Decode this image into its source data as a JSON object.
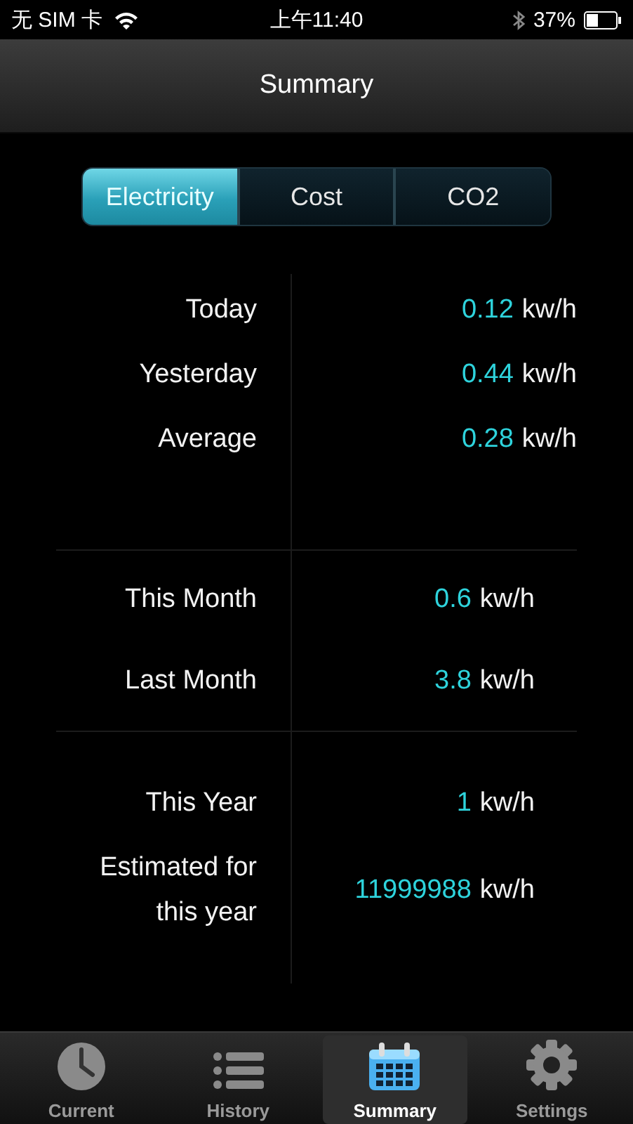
{
  "status_bar": {
    "carrier": "无 SIM 卡",
    "time": "上午11:40",
    "battery": "37%"
  },
  "nav_bar": {
    "title": "Summary"
  },
  "segments": [
    {
      "label": "Electricity",
      "selected": true
    },
    {
      "label": "Cost",
      "selected": false
    },
    {
      "label": "CO2",
      "selected": false
    }
  ],
  "sections": [
    {
      "rows": [
        {
          "label": "Today",
          "value": "0.12",
          "unit": "kw/h"
        },
        {
          "label": "Yesterday",
          "value": "0.44",
          "unit": "kw/h"
        },
        {
          "label": "Average",
          "value": "0.28",
          "unit": "kw/h"
        }
      ]
    },
    {
      "rows": [
        {
          "label": "This Month",
          "value": "0.6",
          "unit": "kw/h"
        },
        {
          "label": "Last Month",
          "value": "3.8",
          "unit": "kw/h"
        }
      ]
    },
    {
      "rows": [
        {
          "label": "This Year",
          "value": "1",
          "unit": "kw/h"
        },
        {
          "label": "Estimated for this year",
          "value": "11999988",
          "unit": "kw/h"
        }
      ]
    }
  ],
  "tab_bar": [
    {
      "label": "Current",
      "kind": "clock",
      "selected": false
    },
    {
      "label": "History",
      "kind": "list",
      "selected": false
    },
    {
      "label": "Summary",
      "kind": "calendar",
      "selected": true
    },
    {
      "label": "Settings",
      "kind": "gear",
      "selected": false
    }
  ]
}
